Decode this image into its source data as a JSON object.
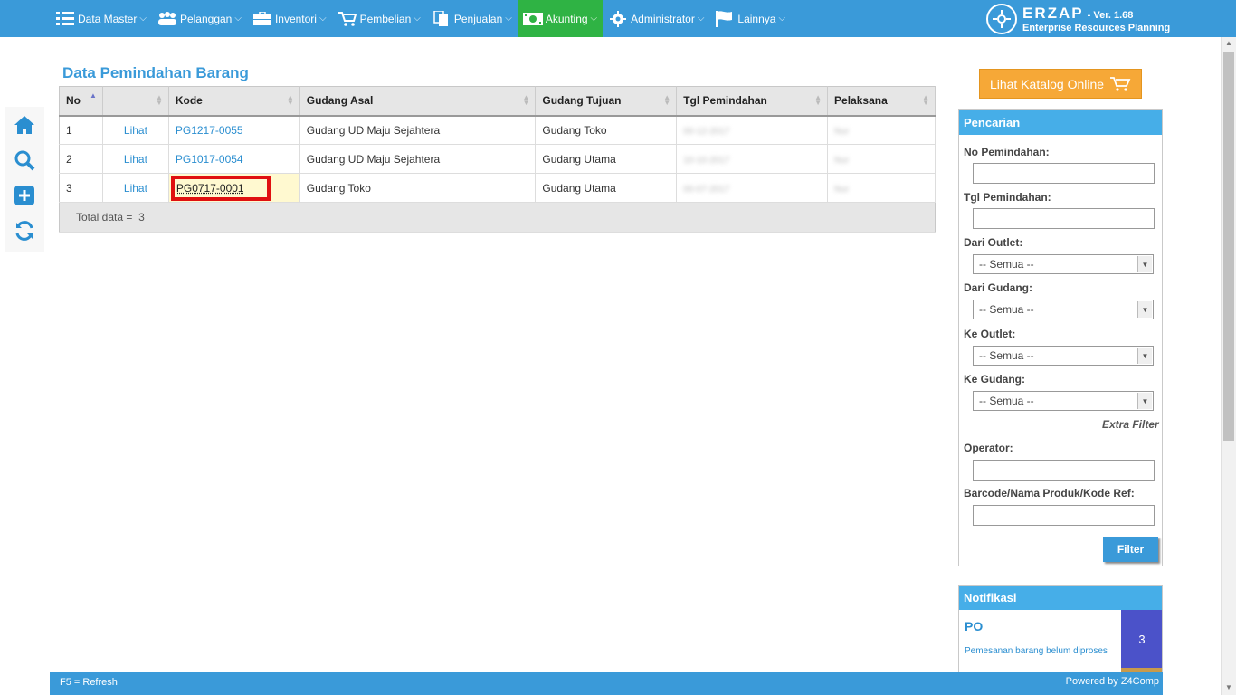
{
  "nav": {
    "items": [
      {
        "label": "Data Master",
        "icon": "list-icon"
      },
      {
        "label": "Pelanggan",
        "icon": "users-icon"
      },
      {
        "label": "Inventori",
        "icon": "briefcase-icon"
      },
      {
        "label": "Pembelian",
        "icon": "cart-icon"
      },
      {
        "label": "Penjualan",
        "icon": "documents-icon"
      },
      {
        "label": "Akunting",
        "icon": "money-icon",
        "active": true
      },
      {
        "label": "Administrator",
        "icon": "gear-icon"
      },
      {
        "label": "Lainnya",
        "icon": "flag-icon"
      }
    ]
  },
  "brand": {
    "name": "ERZAP",
    "version": "- Ver. 1.68",
    "tagline": "Enterprise Resources Planning"
  },
  "page": {
    "title": "Data Pemindahan Barang"
  },
  "table": {
    "columns": [
      "No",
      "",
      "Kode",
      "Gudang Asal",
      "Gudang Tujuan",
      "Tgl Pemindahan",
      "Pelaksana"
    ],
    "rows": [
      {
        "no": "1",
        "action": "Lihat",
        "kode": "PG1217-0055",
        "asal": "Gudang UD Maju Sejahtera",
        "tujuan": "Gudang Toko",
        "tgl": "00-12-2017",
        "pelaksana": "Nur"
      },
      {
        "no": "2",
        "action": "Lihat",
        "kode": "PG1017-0054",
        "asal": "Gudang UD Maju Sejahtera",
        "tujuan": "Gudang Utama",
        "tgl": "10-10-2017",
        "pelaksana": "Nur"
      },
      {
        "no": "3",
        "action": "Lihat",
        "kode": "PG0717-0001",
        "asal": "Gudang Toko",
        "tujuan": "Gudang Utama",
        "tgl": "00-07-2017",
        "pelaksana": "Nur"
      }
    ],
    "total_label": "Total data =",
    "total_value": "3"
  },
  "katalog": {
    "label": "Lihat Katalog Online"
  },
  "search": {
    "title": "Pencarian",
    "no_label": "No Pemindahan:",
    "tgl_label": "Tgl Pemindahan:",
    "dari_outlet_label": "Dari Outlet:",
    "dari_outlet_value": "-- Semua --",
    "dari_gudang_label": "Dari Gudang:",
    "dari_gudang_value": "-- Semua --",
    "ke_outlet_label": "Ke Outlet:",
    "ke_outlet_value": "-- Semua --",
    "ke_gudang_label": "Ke Gudang:",
    "ke_gudang_value": "-- Semua --",
    "extra_filter": "Extra Filter",
    "operator_label": "Operator:",
    "barcode_label": "Barcode/Nama Produk/Kode Ref:",
    "filter_button": "Filter"
  },
  "notif": {
    "title": "Notifikasi",
    "item_title": "PO",
    "item_desc": "Pemesanan barang belum diproses",
    "item_count": "3"
  },
  "footer": {
    "left": "F5 = Refresh",
    "right": "Powered by Z4Comp"
  },
  "colors": {
    "primary": "#3a9ad9",
    "active_nav": "#2fb344",
    "katalog": "#f6a837",
    "highlight": "#e01010"
  }
}
